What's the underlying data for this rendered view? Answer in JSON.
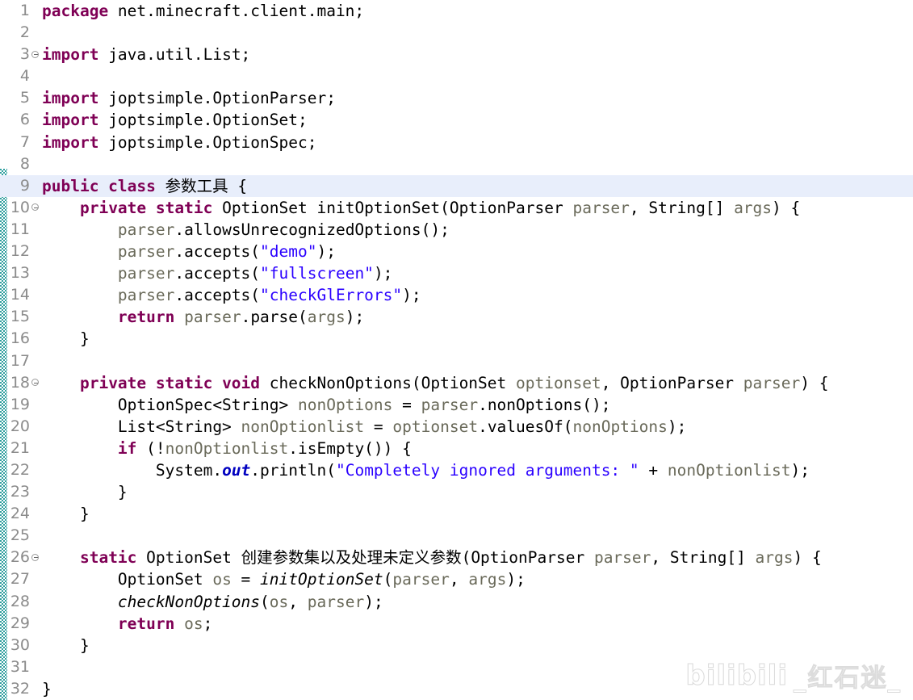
{
  "editor": {
    "language": "java",
    "total_lines": 32,
    "highlighted_line": 9,
    "change_bar_from_line": 9,
    "change_bar_to_line": 32,
    "colors": {
      "background": "#ffffff",
      "keyword": "#7f0055",
      "string": "#2a00ff",
      "variable": "#6a6a5a",
      "static_field": "#0000c0",
      "line_number": "#8b8b8b",
      "current_line_highlight": "#e8eefb",
      "change_bar": "#2e9e9e"
    }
  },
  "lines": [
    {
      "n": "1",
      "fold": false,
      "highlight": false,
      "tokens": [
        {
          "t": "package",
          "c": "kw"
        },
        {
          "t": " net.minecraft.client.main;",
          "c": "plain"
        }
      ]
    },
    {
      "n": "2",
      "fold": false,
      "highlight": false,
      "tokens": []
    },
    {
      "n": "3",
      "fold": true,
      "highlight": false,
      "tokens": [
        {
          "t": "import",
          "c": "kw"
        },
        {
          "t": " java.util.List;",
          "c": "plain"
        }
      ]
    },
    {
      "n": "4",
      "fold": false,
      "highlight": false,
      "tokens": []
    },
    {
      "n": "5",
      "fold": false,
      "highlight": false,
      "tokens": [
        {
          "t": "import",
          "c": "kw"
        },
        {
          "t": " joptsimple.OptionParser;",
          "c": "plain"
        }
      ]
    },
    {
      "n": "6",
      "fold": false,
      "highlight": false,
      "tokens": [
        {
          "t": "import",
          "c": "kw"
        },
        {
          "t": " joptsimple.OptionSet;",
          "c": "plain"
        }
      ]
    },
    {
      "n": "7",
      "fold": false,
      "highlight": false,
      "tokens": [
        {
          "t": "import",
          "c": "kw"
        },
        {
          "t": " joptsimple.OptionSpec;",
          "c": "plain"
        }
      ]
    },
    {
      "n": "8",
      "fold": false,
      "highlight": false,
      "tokens": []
    },
    {
      "n": "9",
      "fold": false,
      "highlight": true,
      "tokens": [
        {
          "t": "public class",
          "c": "kw"
        },
        {
          "t": " ",
          "c": "plain"
        },
        {
          "t": "参数工具",
          "c": "cjk"
        },
        {
          "t": " {",
          "c": "plain"
        }
      ]
    },
    {
      "n": "10",
      "fold": true,
      "highlight": false,
      "tokens": [
        {
          "t": "    ",
          "c": "plain"
        },
        {
          "t": "private static",
          "c": "kw"
        },
        {
          "t": " OptionSet initOptionSet(OptionParser ",
          "c": "plain"
        },
        {
          "t": "parser",
          "c": "var"
        },
        {
          "t": ", String[] ",
          "c": "plain"
        },
        {
          "t": "args",
          "c": "var"
        },
        {
          "t": ") {",
          "c": "plain"
        }
      ]
    },
    {
      "n": "11",
      "fold": false,
      "highlight": false,
      "tokens": [
        {
          "t": "        ",
          "c": "plain"
        },
        {
          "t": "parser",
          "c": "var"
        },
        {
          "t": ".allowsUnrecognizedOptions();",
          "c": "plain"
        }
      ]
    },
    {
      "n": "12",
      "fold": false,
      "highlight": false,
      "tokens": [
        {
          "t": "        ",
          "c": "plain"
        },
        {
          "t": "parser",
          "c": "var"
        },
        {
          "t": ".accepts(",
          "c": "plain"
        },
        {
          "t": "\"demo\"",
          "c": "str"
        },
        {
          "t": ");",
          "c": "plain"
        }
      ]
    },
    {
      "n": "13",
      "fold": false,
      "highlight": false,
      "tokens": [
        {
          "t": "        ",
          "c": "plain"
        },
        {
          "t": "parser",
          "c": "var"
        },
        {
          "t": ".accepts(",
          "c": "plain"
        },
        {
          "t": "\"fullscreen\"",
          "c": "str"
        },
        {
          "t": ");",
          "c": "plain"
        }
      ]
    },
    {
      "n": "14",
      "fold": false,
      "highlight": false,
      "tokens": [
        {
          "t": "        ",
          "c": "plain"
        },
        {
          "t": "parser",
          "c": "var"
        },
        {
          "t": ".accepts(",
          "c": "plain"
        },
        {
          "t": "\"checkGlErrors\"",
          "c": "str"
        },
        {
          "t": ");",
          "c": "plain"
        }
      ]
    },
    {
      "n": "15",
      "fold": false,
      "highlight": false,
      "tokens": [
        {
          "t": "        ",
          "c": "plain"
        },
        {
          "t": "return",
          "c": "kw"
        },
        {
          "t": " ",
          "c": "plain"
        },
        {
          "t": "parser",
          "c": "var"
        },
        {
          "t": ".parse(",
          "c": "plain"
        },
        {
          "t": "args",
          "c": "var"
        },
        {
          "t": ");",
          "c": "plain"
        }
      ]
    },
    {
      "n": "16",
      "fold": false,
      "highlight": false,
      "tokens": [
        {
          "t": "    }",
          "c": "plain"
        }
      ]
    },
    {
      "n": "17",
      "fold": false,
      "highlight": false,
      "tokens": []
    },
    {
      "n": "18",
      "fold": true,
      "highlight": false,
      "tokens": [
        {
          "t": "    ",
          "c": "plain"
        },
        {
          "t": "private static void",
          "c": "kw"
        },
        {
          "t": " checkNonOptions(OptionSet ",
          "c": "plain"
        },
        {
          "t": "optionset",
          "c": "var"
        },
        {
          "t": ", OptionParser ",
          "c": "plain"
        },
        {
          "t": "parser",
          "c": "var"
        },
        {
          "t": ") {",
          "c": "plain"
        }
      ]
    },
    {
      "n": "19",
      "fold": false,
      "highlight": false,
      "tokens": [
        {
          "t": "        OptionSpec<String> ",
          "c": "plain"
        },
        {
          "t": "nonOptions",
          "c": "var"
        },
        {
          "t": " = ",
          "c": "plain"
        },
        {
          "t": "parser",
          "c": "var"
        },
        {
          "t": ".nonOptions();",
          "c": "plain"
        }
      ]
    },
    {
      "n": "20",
      "fold": false,
      "highlight": false,
      "tokens": [
        {
          "t": "        List<String> ",
          "c": "plain"
        },
        {
          "t": "nonOptionlist",
          "c": "var"
        },
        {
          "t": " = ",
          "c": "plain"
        },
        {
          "t": "optionset",
          "c": "var"
        },
        {
          "t": ".valuesOf(",
          "c": "plain"
        },
        {
          "t": "nonOptions",
          "c": "var"
        },
        {
          "t": ");",
          "c": "plain"
        }
      ]
    },
    {
      "n": "21",
      "fold": false,
      "highlight": false,
      "tokens": [
        {
          "t": "        ",
          "c": "plain"
        },
        {
          "t": "if",
          "c": "kw"
        },
        {
          "t": " (!",
          "c": "plain"
        },
        {
          "t": "nonOptionlist",
          "c": "var"
        },
        {
          "t": ".isEmpty()) {",
          "c": "plain"
        }
      ]
    },
    {
      "n": "22",
      "fold": false,
      "highlight": false,
      "tokens": [
        {
          "t": "            System.",
          "c": "plain"
        },
        {
          "t": "out",
          "c": "sfld"
        },
        {
          "t": ".println(",
          "c": "plain"
        },
        {
          "t": "\"Completely ignored arguments: \"",
          "c": "str"
        },
        {
          "t": " + ",
          "c": "plain"
        },
        {
          "t": "nonOptionlist",
          "c": "var"
        },
        {
          "t": ");",
          "c": "plain"
        }
      ]
    },
    {
      "n": "23",
      "fold": false,
      "highlight": false,
      "tokens": [
        {
          "t": "        }",
          "c": "plain"
        }
      ]
    },
    {
      "n": "24",
      "fold": false,
      "highlight": false,
      "tokens": [
        {
          "t": "    }",
          "c": "plain"
        }
      ]
    },
    {
      "n": "25",
      "fold": false,
      "highlight": false,
      "tokens": []
    },
    {
      "n": "26",
      "fold": true,
      "highlight": false,
      "tokens": [
        {
          "t": "    ",
          "c": "plain"
        },
        {
          "t": "static",
          "c": "kw"
        },
        {
          "t": " OptionSet ",
          "c": "plain"
        },
        {
          "t": "创建参数集以及处理未定义参数",
          "c": "cjk"
        },
        {
          "t": "(OptionParser ",
          "c": "plain"
        },
        {
          "t": "parser",
          "c": "var"
        },
        {
          "t": ", String[] ",
          "c": "plain"
        },
        {
          "t": "args",
          "c": "var"
        },
        {
          "t": ") {",
          "c": "plain"
        }
      ]
    },
    {
      "n": "27",
      "fold": false,
      "highlight": false,
      "tokens": [
        {
          "t": "        OptionSet ",
          "c": "plain"
        },
        {
          "t": "os",
          "c": "var"
        },
        {
          "t": " = ",
          "c": "plain"
        },
        {
          "t": "initOptionSet",
          "c": "smth"
        },
        {
          "t": "(",
          "c": "plain"
        },
        {
          "t": "parser",
          "c": "var"
        },
        {
          "t": ", ",
          "c": "plain"
        },
        {
          "t": "args",
          "c": "var"
        },
        {
          "t": ");",
          "c": "plain"
        }
      ]
    },
    {
      "n": "28",
      "fold": false,
      "highlight": false,
      "tokens": [
        {
          "t": "        ",
          "c": "plain"
        },
        {
          "t": "checkNonOptions",
          "c": "smth"
        },
        {
          "t": "(",
          "c": "plain"
        },
        {
          "t": "os",
          "c": "var"
        },
        {
          "t": ", ",
          "c": "plain"
        },
        {
          "t": "parser",
          "c": "var"
        },
        {
          "t": ");",
          "c": "plain"
        }
      ]
    },
    {
      "n": "29",
      "fold": false,
      "highlight": false,
      "tokens": [
        {
          "t": "        ",
          "c": "plain"
        },
        {
          "t": "return",
          "c": "kw"
        },
        {
          "t": " ",
          "c": "plain"
        },
        {
          "t": "os",
          "c": "var"
        },
        {
          "t": ";",
          "c": "plain"
        }
      ]
    },
    {
      "n": "30",
      "fold": false,
      "highlight": false,
      "tokens": [
        {
          "t": "    }",
          "c": "plain"
        }
      ]
    },
    {
      "n": "31",
      "fold": false,
      "highlight": false,
      "tokens": []
    },
    {
      "n": "32",
      "fold": false,
      "highlight": false,
      "tokens": [
        {
          "t": "}",
          "c": "plain"
        }
      ]
    }
  ],
  "watermark": {
    "brand": "bilibili",
    "user": "_红石迷_"
  }
}
